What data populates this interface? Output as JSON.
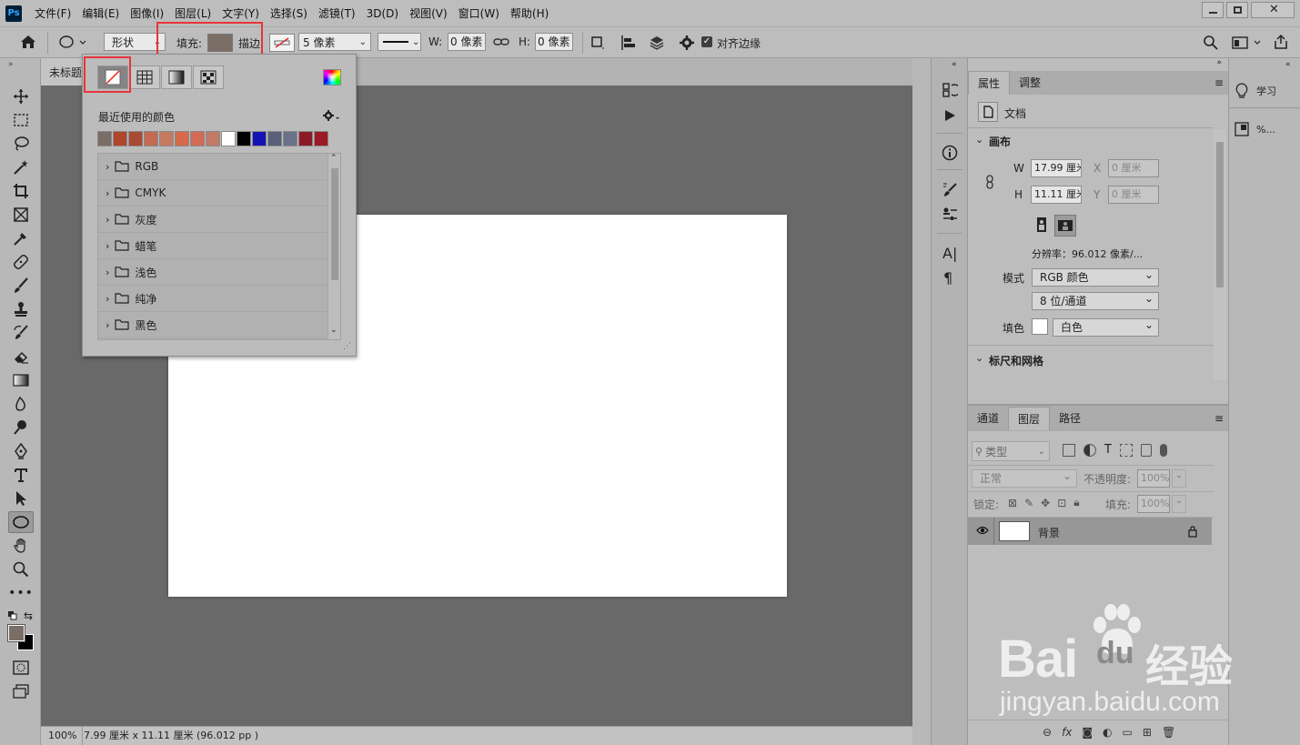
{
  "app": {
    "logo": "Ps"
  },
  "menu": [
    "文件(F)",
    "编辑(E)",
    "图像(I)",
    "图层(L)",
    "文字(Y)",
    "选择(S)",
    "滤镜(T)",
    "3D(D)",
    "视图(V)",
    "窗口(W)",
    "帮助(H)"
  ],
  "options": {
    "mode_value": "形状",
    "fill_label": "填充:",
    "fill_color": "#7a6e66",
    "stroke_label": "描边",
    "stroke_width": "5 像素",
    "w_label": "W:",
    "w_value": "0 像素",
    "h_label": "H:",
    "h_value": "0 像素",
    "align_edges_label": "对齐边缘"
  },
  "document": {
    "tab_title": "未标题",
    "zoom": "100%",
    "status": "7.99 厘米 x 11.11 厘米 (96.012 pp )"
  },
  "swatches": {
    "recent_label": "最近使用的颜色",
    "recent_colors": [
      "#7a6e66",
      "#b0452c",
      "#a84a34",
      "#c46a53",
      "#c77a62",
      "#d46a4a",
      "#d26a55",
      "#c17a66",
      "#ffffff",
      "#000000",
      "#1313b4",
      "#5a6079",
      "#6c718a",
      "#8c1a26",
      "#9c1a24"
    ],
    "folders": [
      "RGB",
      "CMYK",
      "灰度",
      "蜡笔",
      "浅色",
      "纯净",
      "黑色"
    ]
  },
  "properties": {
    "tabs": [
      "属性",
      "调整"
    ],
    "doc_label": "文档",
    "canvas_section": "画布",
    "w_label": "W",
    "w_value": "17.99 厘米",
    "h_label": "H",
    "h_value": "11.11 厘米",
    "x_label": "X",
    "x_value": "0 厘米",
    "y_label": "Y",
    "y_value": "0 厘米",
    "resolution": "分辨率：96.012 像素/...",
    "mode_label": "模式",
    "mode_value": "RGB 颜色",
    "depth_value": "8 位/通道",
    "fill_label": "填色",
    "fill_value": "白色",
    "rulers_section": "标尺和网格"
  },
  "layers": {
    "tabs": [
      "通道",
      "图层",
      "路径"
    ],
    "filter_label": "类型",
    "blend_mode": "正常",
    "opacity_label": "不透明度:",
    "opacity_value": "100%",
    "lock_label": "锁定:",
    "fill_label": "填充:",
    "fill_value": "100%",
    "layer_name": "背景"
  },
  "learn": {
    "learn_label": "学习",
    "percent_label": "%..."
  },
  "watermark": {
    "brand": "Bai",
    "brand2": "du",
    "cn": "经验",
    "url": "jingyan.baidu.com"
  }
}
